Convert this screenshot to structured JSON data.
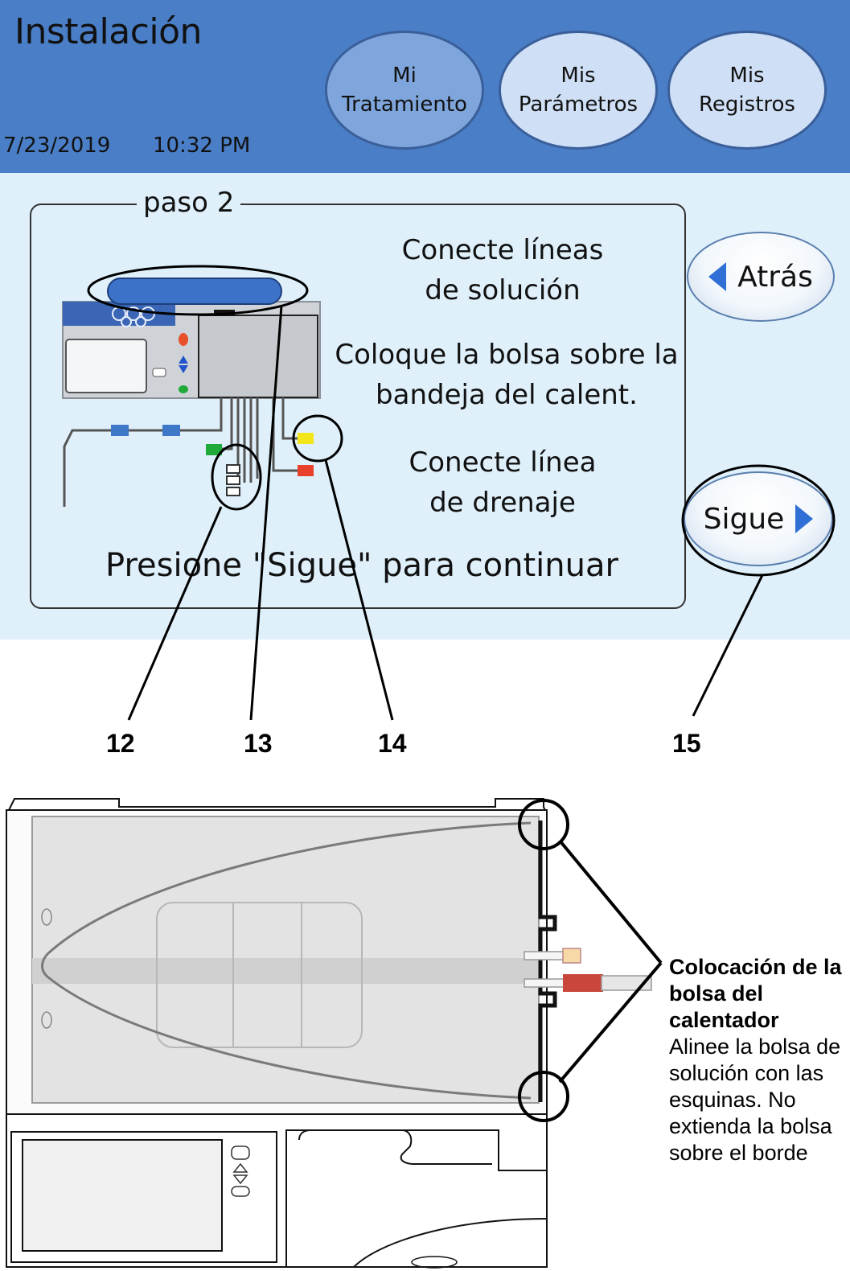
{
  "header": {
    "title": "Instalación",
    "date": "7/23/2019",
    "time": "10:32 PM",
    "tabs": [
      {
        "line1": "Mi",
        "line2": "Tratamiento"
      },
      {
        "line1": "Mis",
        "line2": "Parámetros"
      },
      {
        "line1": "Mis",
        "line2": "Registros"
      }
    ]
  },
  "step": {
    "label": "paso 2",
    "instruction_1": [
      "Conecte líneas",
      "de solución"
    ],
    "instruction_2": [
      "Coloque la bolsa sobre la",
      "bandeja del calent."
    ],
    "instruction_3": [
      "Conecte línea",
      "de drenaje"
    ],
    "continue_text": "Presione \"Sigue\" para continuar"
  },
  "buttons": {
    "back_label": "Atrás",
    "next_label": "Sigue"
  },
  "callouts": [
    "12",
    "13",
    "14",
    "15"
  ],
  "caption": {
    "title": "Colocación de la bolsa del calentador",
    "body": "Alinee la bolsa de solución con las esquinas. No extienda la bolsa sobre el borde"
  },
  "colors": {
    "header": "#4a7ec6",
    "panel": "#dff0fb",
    "active_tab": "#7fa6dc",
    "tab": "#cfdff5",
    "arrow": "#2f6fd6"
  },
  "icons": [
    "chevron-left-icon",
    "chevron-right-icon",
    "cycler-machine-icon",
    "heater-tray-icon"
  ]
}
